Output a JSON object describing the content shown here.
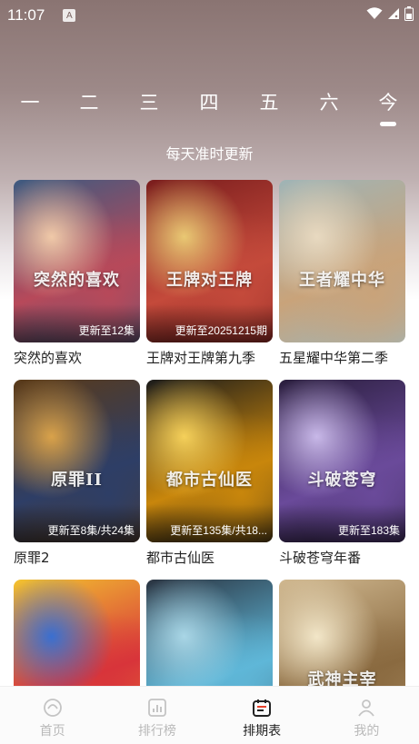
{
  "status_bar": {
    "time": "11:07",
    "indicator": "A"
  },
  "weekdays": [
    "一",
    "二",
    "三",
    "四",
    "五",
    "六",
    "今"
  ],
  "active_weekday": "今",
  "subtitle": "每天准时更新",
  "shows": [
    {
      "title": "突然的喜欢",
      "badge": "更新至12集",
      "poster_text": "突然的喜欢",
      "colors": [
        "#3d5a80",
        "#b7495a",
        "#f0c9a8"
      ]
    },
    {
      "title": "王牌对王牌第九季",
      "badge": "更新至20251215期",
      "poster_text": "王牌对王牌",
      "colors": [
        "#7a1d1d",
        "#c44a3b",
        "#e9c873"
      ]
    },
    {
      "title": "五星耀中华第二季",
      "badge": "",
      "poster_text": "王者耀中华",
      "colors": [
        "#9fb4b6",
        "#c9a37a",
        "#e8d9c0"
      ]
    },
    {
      "title": "原罪2",
      "badge": "更新至8集/共24集",
      "poster_text": "原罪II",
      "colors": [
        "#5a3a18",
        "#2e3e66",
        "#d9a24a"
      ]
    },
    {
      "title": "都市古仙医",
      "badge": "更新至135集/共18...",
      "poster_text": "都市古仙医",
      "colors": [
        "#1b1b1b",
        "#c8860c",
        "#f5d05a"
      ]
    },
    {
      "title": "斗破苍穹年番",
      "badge": "更新至183集",
      "poster_text": "斗破苍穹",
      "colors": [
        "#2a1e3d",
        "#6a4a9a",
        "#c8b8e8"
      ]
    },
    {
      "title": "",
      "badge": "",
      "poster_text": "",
      "colors": [
        "#f2c230",
        "#d8343a",
        "#3a6fd0"
      ]
    },
    {
      "title": "",
      "badge": "",
      "poster_text": "",
      "colors": [
        "#2a3340",
        "#5fb7d8",
        "#a9d6e6"
      ]
    },
    {
      "title": "",
      "badge": "",
      "poster_text": "武神主宰",
      "colors": [
        "#d0b890",
        "#8a6a40",
        "#f2e6c8"
      ]
    }
  ],
  "bottom_nav": [
    {
      "label": "首页",
      "icon": "home-icon",
      "active": false
    },
    {
      "label": "排行榜",
      "icon": "ranking-icon",
      "active": false
    },
    {
      "label": "排期表",
      "icon": "schedule-icon",
      "active": true
    },
    {
      "label": "我的",
      "icon": "profile-icon",
      "active": false
    }
  ]
}
